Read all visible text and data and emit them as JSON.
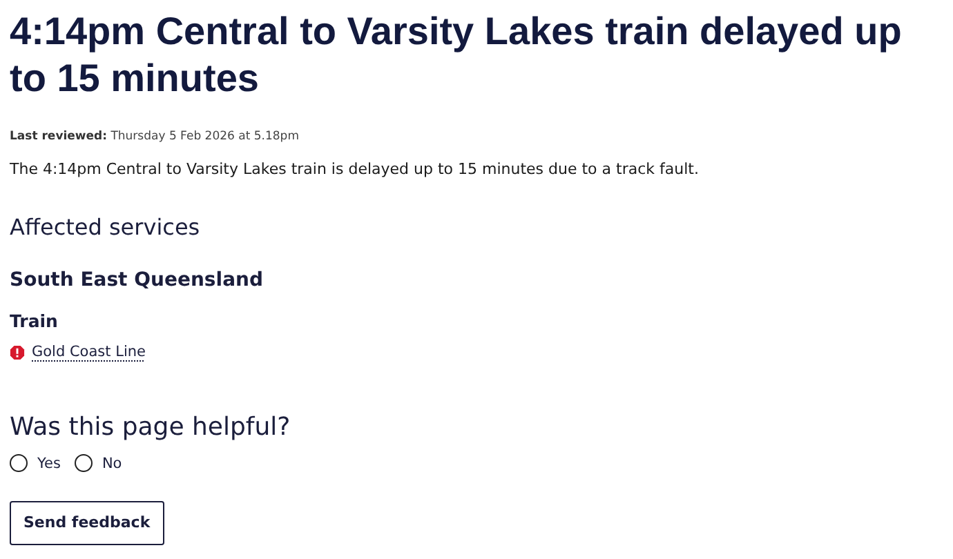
{
  "title": "4:14pm Central to Varsity Lakes train delayed up to 15 minutes",
  "last_reviewed": {
    "label": "Last reviewed:",
    "value": "Thursday 5 Feb 2026 at 5.18pm"
  },
  "summary": "The 4:14pm Central to Varsity Lakes train is delayed up to 15 minutes due to a track fault.",
  "affected": {
    "heading": "Affected services",
    "region": "South East Queensland",
    "mode": "Train",
    "lines": [
      {
        "name": "Gold Coast Line",
        "kind": "alert"
      }
    ]
  },
  "feedback": {
    "question": "Was this page helpful?",
    "options": [
      {
        "label": "Yes",
        "selected": false
      },
      {
        "label": "No",
        "selected": false
      }
    ],
    "button": "Send feedback"
  }
}
